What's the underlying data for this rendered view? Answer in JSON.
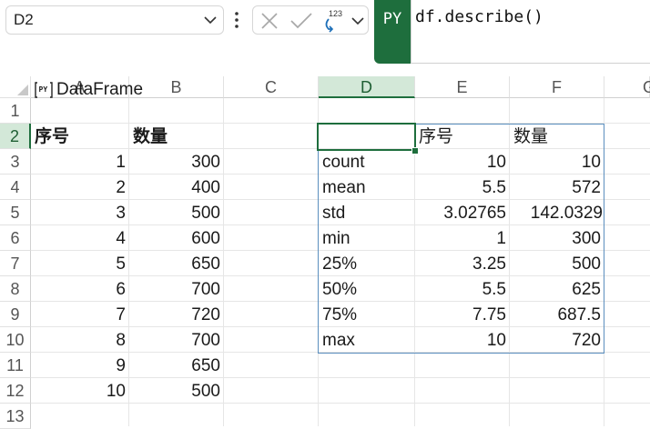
{
  "name_box": {
    "value": "D2"
  },
  "python_badge": "PY",
  "formula": "df.describe()",
  "columns": [
    "A",
    "B",
    "C",
    "D",
    "E",
    "F",
    "G"
  ],
  "rows": [
    "1",
    "2",
    "3",
    "4",
    "5",
    "6",
    "7",
    "8",
    "9",
    "10",
    "11",
    "12",
    "13"
  ],
  "active_column": "D",
  "active_row": "2",
  "dataframe_label": "DataFrame",
  "source_table": {
    "headers": [
      "序号",
      "数量"
    ],
    "rows": [
      [
        "1",
        "300"
      ],
      [
        "2",
        "400"
      ],
      [
        "3",
        "500"
      ],
      [
        "4",
        "600"
      ],
      [
        "5",
        "650"
      ],
      [
        "6",
        "700"
      ],
      [
        "7",
        "720"
      ],
      [
        "8",
        "700"
      ],
      [
        "9",
        "650"
      ],
      [
        "10",
        "500"
      ]
    ]
  },
  "describe_table": {
    "corner": "",
    "headers": [
      "序号",
      "数量"
    ],
    "rows": [
      {
        "stat": "count",
        "a": "10",
        "b": "10"
      },
      {
        "stat": "mean",
        "a": "5.5",
        "b": "572"
      },
      {
        "stat": "std",
        "a": "3.02765",
        "b": "142.0329"
      },
      {
        "stat": "min",
        "a": "1",
        "b": "300"
      },
      {
        "stat": "25%",
        "a": "3.25",
        "b": "500"
      },
      {
        "stat": "50%",
        "a": "5.5",
        "b": "625"
      },
      {
        "stat": "75%",
        "a": "7.75",
        "b": "687.5"
      },
      {
        "stat": "max",
        "a": "10",
        "b": "720"
      }
    ]
  },
  "icons": {
    "cancel": "x-icon",
    "enter": "check-icon",
    "output_type": "123-output-icon",
    "more": "vertical-dots-icon"
  },
  "colors": {
    "accent": "#1e6e3d",
    "header_active_bg": "#d3e8d8",
    "spill_border": "#5b8fbf"
  }
}
